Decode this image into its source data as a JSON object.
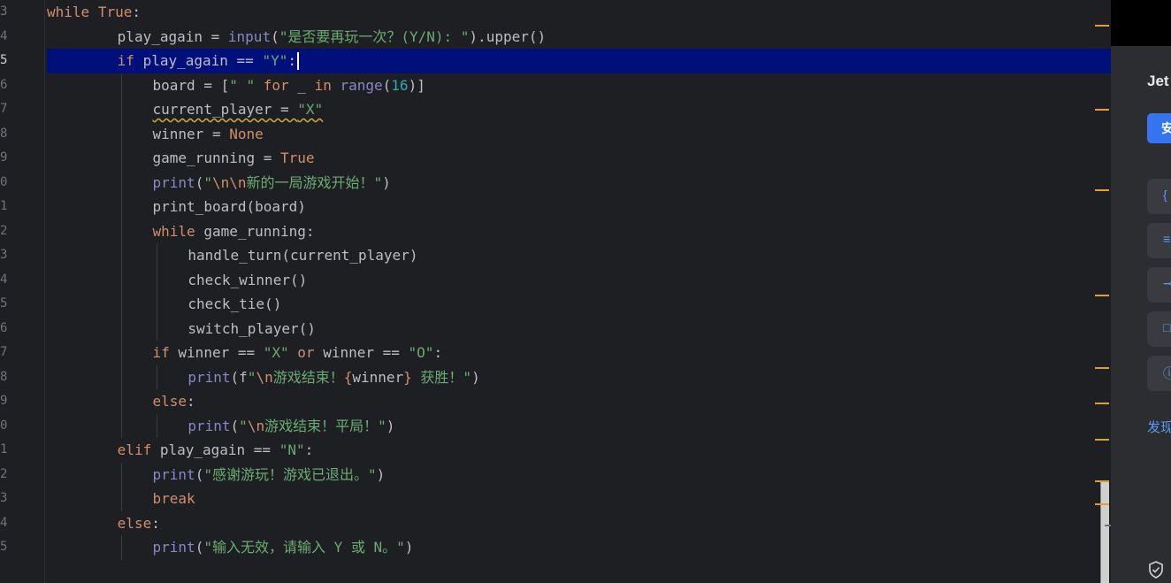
{
  "gutter": {
    "line_numbers": [
      "3",
      "4",
      "5",
      "6",
      "7",
      "8",
      "9",
      "0",
      "1",
      "2",
      "3",
      "4",
      "5",
      "6",
      "7",
      "8",
      "9",
      "0",
      "1",
      "2",
      "3",
      "4",
      "5"
    ],
    "current_index": 2
  },
  "code": {
    "lines": [
      {
        "indent": 0,
        "tokens": [
          {
            "t": "while",
            "k": "kw"
          },
          {
            "t": " "
          },
          {
            "t": "True",
            "k": "kw"
          },
          {
            "t": ":"
          }
        ]
      },
      {
        "indent": 2,
        "tokens": [
          {
            "t": "play_again = "
          },
          {
            "t": "input",
            "k": "bi"
          },
          {
            "t": "("
          },
          {
            "t": "\"是否要再玩一次？(Y/N): \"",
            "k": "str"
          },
          {
            "t": ").upper()"
          }
        ]
      },
      {
        "indent": 2,
        "tokens": [
          {
            "t": "if",
            "k": "kw"
          },
          {
            "t": " play_again == "
          },
          {
            "t": "\"Y\"",
            "k": "str"
          },
          {
            "t": ":"
          }
        ]
      },
      {
        "indent": 3,
        "tokens": [
          {
            "t": "board = ["
          },
          {
            "t": "\" \"",
            "k": "str"
          },
          {
            "t": " "
          },
          {
            "t": "for",
            "k": "kw"
          },
          {
            "t": " _ "
          },
          {
            "t": "in",
            "k": "kw"
          },
          {
            "t": " "
          },
          {
            "t": "range",
            "k": "bi"
          },
          {
            "t": "("
          },
          {
            "t": "16",
            "k": "num"
          },
          {
            "t": ")]"
          }
        ]
      },
      {
        "indent": 3,
        "tokens": [
          {
            "t": "current_player = ",
            "k": "warn"
          },
          {
            "t": "\"X\"",
            "k": "str warn"
          }
        ]
      },
      {
        "indent": 3,
        "tokens": [
          {
            "t": "winner = "
          },
          {
            "t": "None",
            "k": "kw"
          }
        ]
      },
      {
        "indent": 3,
        "tokens": [
          {
            "t": "game_running = "
          },
          {
            "t": "True",
            "k": "kw"
          }
        ]
      },
      {
        "indent": 3,
        "tokens": [
          {
            "t": "print",
            "k": "bi"
          },
          {
            "t": "("
          },
          {
            "t": "\"",
            "k": "str"
          },
          {
            "t": "\\n\\n",
            "k": "esc"
          },
          {
            "t": "新的一局游戏开始！\"",
            "k": "str"
          },
          {
            "t": ")"
          }
        ]
      },
      {
        "indent": 3,
        "tokens": [
          {
            "t": "print_board(board)"
          }
        ]
      },
      {
        "indent": 3,
        "tokens": [
          {
            "t": "while",
            "k": "kw"
          },
          {
            "t": " game_running:"
          }
        ]
      },
      {
        "indent": 4,
        "tokens": [
          {
            "t": "handle_turn(current_player)"
          }
        ]
      },
      {
        "indent": 4,
        "tokens": [
          {
            "t": "check_winner()"
          }
        ]
      },
      {
        "indent": 4,
        "tokens": [
          {
            "t": "check_tie()"
          }
        ]
      },
      {
        "indent": 4,
        "tokens": [
          {
            "t": "switch_player()"
          }
        ]
      },
      {
        "indent": 3,
        "tokens": [
          {
            "t": "if",
            "k": "kw"
          },
          {
            "t": " winner == "
          },
          {
            "t": "\"X\"",
            "k": "str"
          },
          {
            "t": " "
          },
          {
            "t": "or",
            "k": "kw"
          },
          {
            "t": " winner == "
          },
          {
            "t": "\"O\"",
            "k": "str"
          },
          {
            "t": ":"
          }
        ]
      },
      {
        "indent": 4,
        "tokens": [
          {
            "t": "print",
            "k": "bi"
          },
          {
            "t": "(f"
          },
          {
            "t": "\"",
            "k": "str"
          },
          {
            "t": "\\n",
            "k": "esc"
          },
          {
            "t": "游戏结束！",
            "k": "str"
          },
          {
            "t": "{",
            "k": "brace"
          },
          {
            "t": "winner"
          },
          {
            "t": "}",
            "k": "brace"
          },
          {
            "t": " 获胜！\"",
            "k": "str"
          },
          {
            "t": ")"
          }
        ]
      },
      {
        "indent": 3,
        "tokens": [
          {
            "t": "else",
            "k": "kw"
          },
          {
            "t": ":"
          }
        ]
      },
      {
        "indent": 4,
        "tokens": [
          {
            "t": "print",
            "k": "bi"
          },
          {
            "t": "("
          },
          {
            "t": "\"",
            "k": "str"
          },
          {
            "t": "\\n",
            "k": "esc"
          },
          {
            "t": "游戏结束！平局！\"",
            "k": "str"
          },
          {
            "t": ")"
          }
        ]
      },
      {
        "indent": 2,
        "tokens": [
          {
            "t": "elif",
            "k": "kw"
          },
          {
            "t": " play_again == "
          },
          {
            "t": "\"N\"",
            "k": "str"
          },
          {
            "t": ":"
          }
        ]
      },
      {
        "indent": 3,
        "tokens": [
          {
            "t": "print",
            "k": "bi"
          },
          {
            "t": "("
          },
          {
            "t": "\"感谢游玩！游戏已退出。\"",
            "k": "str"
          },
          {
            "t": ")"
          }
        ]
      },
      {
        "indent": 3,
        "tokens": [
          {
            "t": "break",
            "k": "kw"
          }
        ]
      },
      {
        "indent": 2,
        "tokens": [
          {
            "t": "else",
            "k": "kw"
          },
          {
            "t": ":"
          }
        ]
      },
      {
        "indent": 3,
        "tokens": [
          {
            "t": "print",
            "k": "bi"
          },
          {
            "t": "("
          },
          {
            "t": "\"输入无效，请输入 Y 或 N。\"",
            "k": "str"
          },
          {
            "t": ")"
          }
        ]
      }
    ]
  },
  "side_panel": {
    "title": "Jet",
    "install_label": "安",
    "tiles": [
      {
        "icon": "braces-icon",
        "glyph": "{"
      },
      {
        "icon": "list-icon",
        "glyph": "≡"
      },
      {
        "icon": "commit-icon",
        "glyph": "⊸"
      },
      {
        "icon": "window-icon",
        "glyph": "□"
      },
      {
        "icon": "info-icon",
        "glyph": "ⓘ"
      }
    ],
    "discover_label": "发现",
    "shield_icon": "shield-check-icon"
  },
  "colors": {
    "background": "#1e1f22",
    "selection": "#000f7a",
    "keyword": "#cf8e6d",
    "string": "#6aab73",
    "number": "#2aacb8",
    "builtin": "#8888c6",
    "accent": "#3574f0"
  }
}
